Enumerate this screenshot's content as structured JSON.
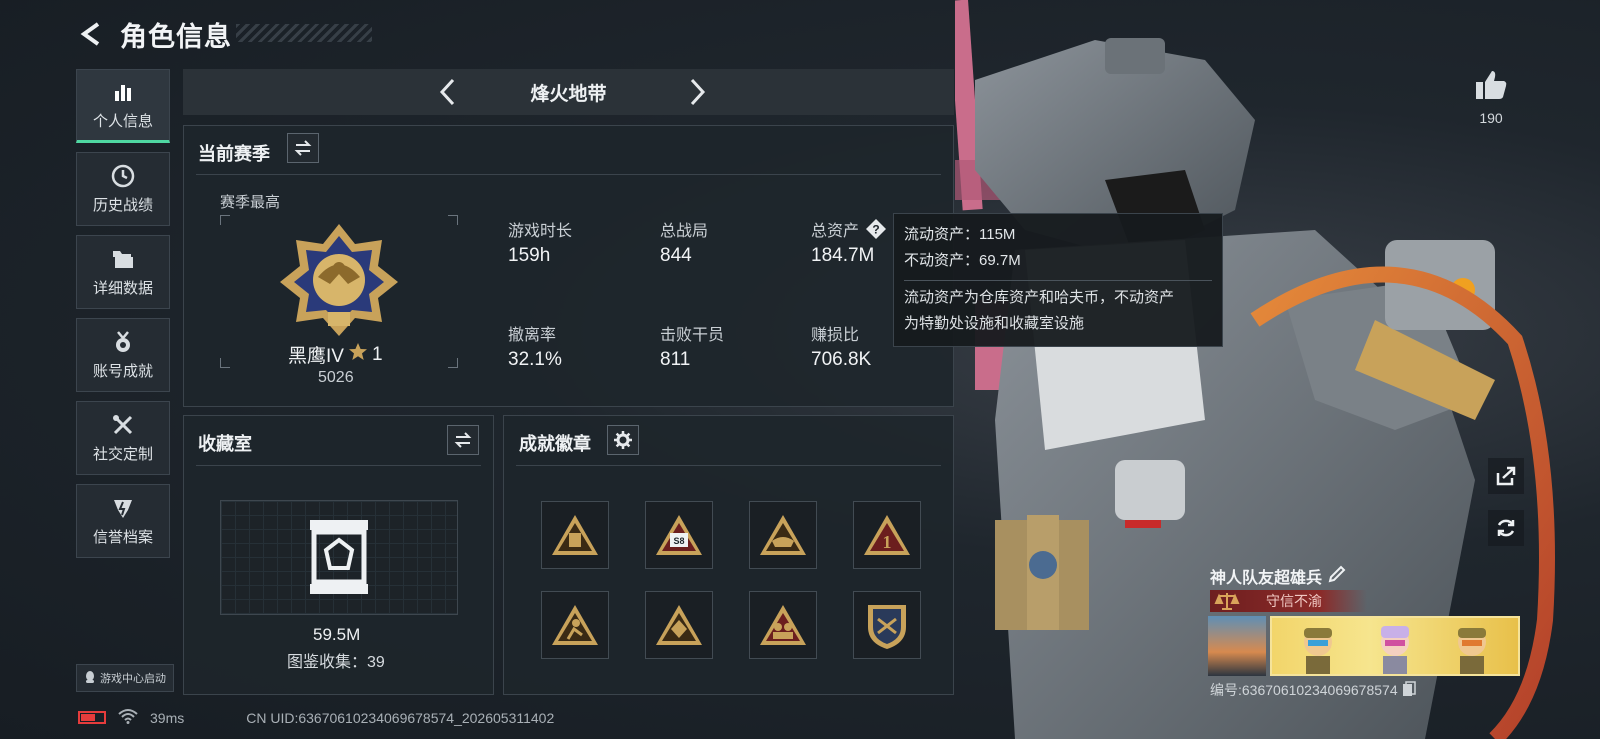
{
  "header": {
    "title": "角色信息",
    "back_icon": "back-arrow-icon"
  },
  "nav": {
    "items": [
      {
        "label": "个人信息",
        "icon": "bar-chart-icon",
        "active": true
      },
      {
        "label": "历史战绩",
        "icon": "clock-icon",
        "active": false
      },
      {
        "label": "详细数据",
        "icon": "folder-icon",
        "active": false
      },
      {
        "label": "账号成就",
        "icon": "medal-icon",
        "active": false
      },
      {
        "label": "社交定制",
        "icon": "tools-icon",
        "active": false
      },
      {
        "label": "信誉档案",
        "icon": "shield-icon",
        "active": false
      }
    ],
    "launch_label": "游戏中心启动"
  },
  "mode": {
    "name": "烽火地带"
  },
  "season": {
    "title": "当前赛季",
    "subtitle": "赛季最高",
    "rank_name": "黑鹰IV",
    "rank_stars": "1",
    "rank_score": "5026",
    "stats": [
      {
        "label": "游戏时长",
        "value": "159h"
      },
      {
        "label": "总战局",
        "value": "844"
      },
      {
        "label": "总资产",
        "value": "184.7M"
      },
      {
        "label": "撤离率",
        "value": "32.1%"
      },
      {
        "label": "击败干员",
        "value": "811"
      },
      {
        "label": "赚损比",
        "value": "706.8K"
      }
    ]
  },
  "tooltip": {
    "line1": "流动资产：115M",
    "line2": "不动资产：69.7M",
    "desc1": "流动资产为仓库资产和哈夫币，不动资产",
    "desc2": "为特勤处设施和收藏室设施"
  },
  "collection": {
    "title": "收藏室",
    "value": "59.5M",
    "count": "图鉴收集：39"
  },
  "achievements": {
    "title": "成就徽章",
    "badges": [
      "badge-1",
      "badge-2",
      "badge-3",
      "badge-4",
      "badge-5",
      "badge-6",
      "badge-7",
      "badge-8"
    ]
  },
  "profile": {
    "likes": "190",
    "player_name": "神人队友超雄兵",
    "motto": "守信不渝",
    "player_id": "编号:63670610234069678574"
  },
  "status": {
    "ping": "39ms",
    "uid": "CN UID:63670610234069678574_202605311402"
  },
  "colors": {
    "accent": "#4fd8a2",
    "gold": "#c8a25a",
    "motto_red": "#8b2a28",
    "battery_red": "#e53c3c"
  }
}
